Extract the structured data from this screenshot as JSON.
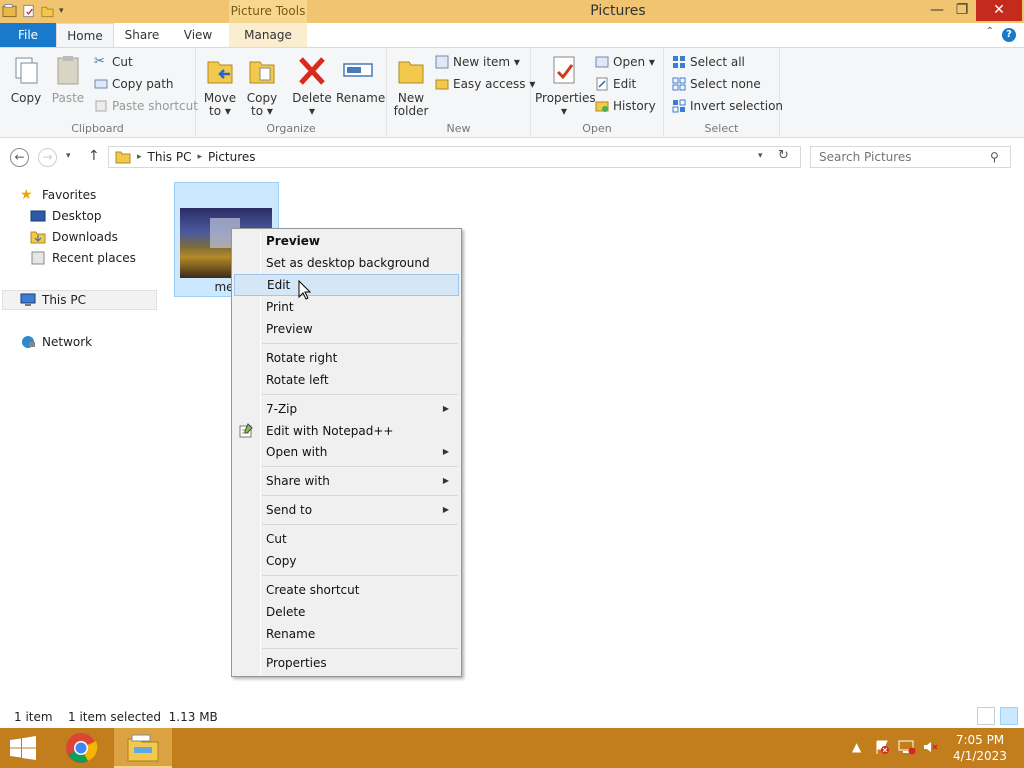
{
  "window": {
    "title": "Pictures",
    "contextual_tab": "Picture Tools",
    "buttons": {
      "minimize": "—",
      "maximize": "❐",
      "close": "✕"
    }
  },
  "tabs": [
    "File",
    "Home",
    "Share",
    "View",
    "Manage"
  ],
  "ribbon": {
    "clipboard": {
      "label": "Clipboard",
      "copy": "Copy",
      "paste": "Paste",
      "cut": "Cut",
      "copy_path": "Copy path",
      "paste_shortcut": "Paste shortcut"
    },
    "organize": {
      "label": "Organize",
      "move_to": [
        "Move",
        "to ▾"
      ],
      "copy_to": [
        "Copy",
        "to ▾"
      ],
      "delete": [
        "Delete",
        "▾"
      ],
      "rename": "Rename"
    },
    "new": {
      "label": "New",
      "new_folder": [
        "New",
        "folder"
      ],
      "new_item": "New item ▾",
      "easy_access": "Easy access ▾"
    },
    "open": {
      "label": "Open",
      "properties": [
        "Properties",
        "▾"
      ],
      "open": "Open ▾",
      "edit": "Edit",
      "history": "History"
    },
    "select": {
      "label": "Select",
      "select_all": "Select all",
      "select_none": "Select none",
      "invert_selection": "Invert selection"
    }
  },
  "address": {
    "path": [
      "This PC",
      "Pictures"
    ],
    "search_placeholder": "Search Pictures"
  },
  "nav": {
    "favorites": "Favorites",
    "desktop": "Desktop",
    "downloads": "Downloads",
    "recent": "Recent places",
    "this_pc": "This PC",
    "network": "Network"
  },
  "file": {
    "name": "mer"
  },
  "context_menu": {
    "items": [
      "Preview",
      "Set as desktop background",
      "Edit",
      "Print",
      "Preview",
      "Rotate right",
      "Rotate left",
      "7-Zip",
      "Edit with Notepad++",
      "Open with",
      "Share with",
      "Send to",
      "Cut",
      "Copy",
      "Create shortcut",
      "Delete",
      "Rename",
      "Properties"
    ]
  },
  "status": {
    "items": "1 item",
    "selected": "1 item selected  1.13 MB"
  },
  "taskbar": {
    "time": "7:05 PM",
    "date": "4/1/2023"
  },
  "colors": {
    "title_bar": "#f0c470",
    "file_tab": "#1979ca",
    "taskbar": "#c27e1c",
    "selection": "#cce8ff",
    "close_button": "#c42b1c"
  }
}
